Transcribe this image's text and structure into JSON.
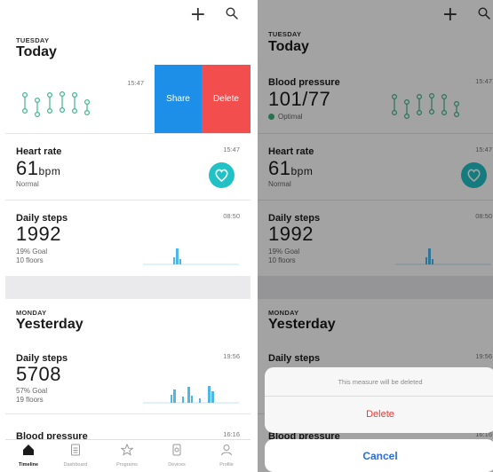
{
  "left": {
    "toolbar": {
      "add_glyph": "+",
      "add_icon": "plus-icon",
      "search_icon": "search-icon"
    },
    "today": {
      "weekday": "TUESDAY",
      "title": "Today"
    },
    "swiped_card": {
      "time": "15:47",
      "share_label": "Share",
      "delete_label": "Delete"
    },
    "heart": {
      "title": "Heart rate",
      "time": "15:47",
      "value": "61",
      "unit": "bpm",
      "status": "Normal",
      "icon": "heart-icon"
    },
    "steps_today": {
      "title": "Daily steps",
      "time": "08:50",
      "value": "1992",
      "goal": "19% Goal",
      "floors": "10 floors"
    },
    "yesterday": {
      "weekday": "MONDAY",
      "title": "Yesterday"
    },
    "steps_yesterday": {
      "title": "Daily steps",
      "time": "19:56",
      "value": "5708",
      "goal": "57% Goal",
      "floors": "19 floors"
    },
    "bp_partial": {
      "title": "Blood pressure",
      "time": "16:16"
    },
    "tabs": [
      {
        "label": "Timeline",
        "icon": "home-icon",
        "active": true
      },
      {
        "label": "Dashboard",
        "icon": "dashboard-icon"
      },
      {
        "label": "Programs",
        "icon": "star-icon"
      },
      {
        "label": "Devices",
        "icon": "watch-icon"
      },
      {
        "label": "Profile",
        "icon": "profile-icon"
      }
    ]
  },
  "right": {
    "toolbar": {
      "add_glyph": "+",
      "add_icon": "plus-icon",
      "search_icon": "search-icon"
    },
    "today": {
      "weekday": "TUESDAY",
      "title": "Today"
    },
    "bp_card": {
      "title": "Blood pressure",
      "time": "15:47",
      "value": "101/77",
      "status": "Optimal"
    },
    "heart": {
      "title": "Heart rate",
      "time": "15:47",
      "value": "61",
      "unit": "bpm",
      "status": "Normal",
      "icon": "heart-icon"
    },
    "steps_today": {
      "title": "Daily steps",
      "time": "08:50",
      "value": "1992",
      "goal": "19% Goal",
      "floors": "10 floors"
    },
    "yesterday": {
      "weekday": "MONDAY",
      "title": "Yesterday"
    },
    "steps_yesterday": {
      "title": "Daily steps",
      "time": "19:56"
    },
    "bp_partial": {
      "title": "Blood pressure",
      "time": "16:16"
    },
    "sheet": {
      "message": "This measure will be deleted",
      "delete_label": "Delete",
      "cancel_label": "Cancel"
    }
  },
  "colors": {
    "accent_blue": "#1e8fe8",
    "delete_red": "#f24e4e",
    "teal": "#21c1c6",
    "chart_blue": "#4fb6e8",
    "ok_green": "#3db37a"
  }
}
